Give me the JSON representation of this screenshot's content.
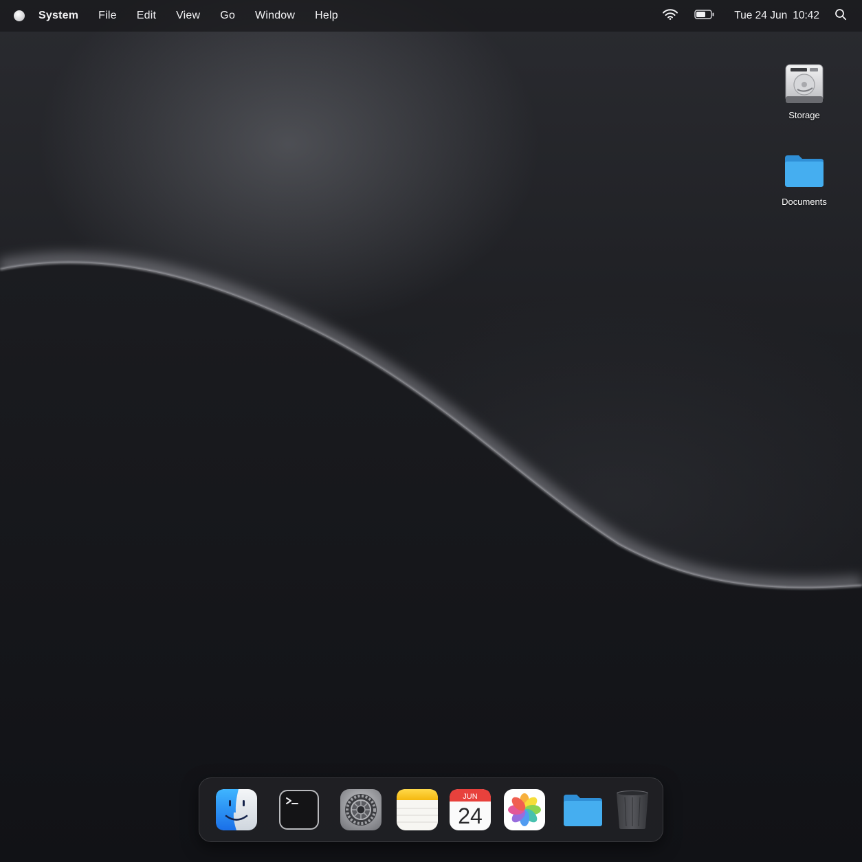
{
  "menubar": {
    "app_name": "System",
    "menus": [
      "File",
      "Edit",
      "View",
      "Go",
      "Window",
      "Help"
    ],
    "status": {
      "wifi_icon": "wifi-icon",
      "battery_icon": "battery-icon",
      "date": "Tue 24 Jun",
      "time": "10:42",
      "search_icon": "search-icon"
    }
  },
  "desktop": {
    "icons": [
      {
        "label": "Storage",
        "icon": "hard-drive-icon"
      },
      {
        "label": "Documents",
        "icon": "folder-icon"
      }
    ]
  },
  "dock": {
    "apps": [
      {
        "name": "finder",
        "icon": "finder-icon"
      },
      {
        "name": "terminal",
        "icon": "terminal-icon"
      },
      {
        "name": "settings",
        "icon": "gear-icon"
      },
      {
        "name": "notes",
        "icon": "notes-icon"
      },
      {
        "name": "calendar",
        "icon": "calendar-icon",
        "month": "JUN",
        "day": "24"
      },
      {
        "name": "photos",
        "icon": "photos-icon"
      },
      {
        "name": "files",
        "icon": "folder-icon"
      },
      {
        "name": "trash",
        "icon": "trash-icon"
      }
    ]
  },
  "colors": {
    "folder_blue": "#3aa3e8",
    "calendar_red": "#e8413c"
  }
}
